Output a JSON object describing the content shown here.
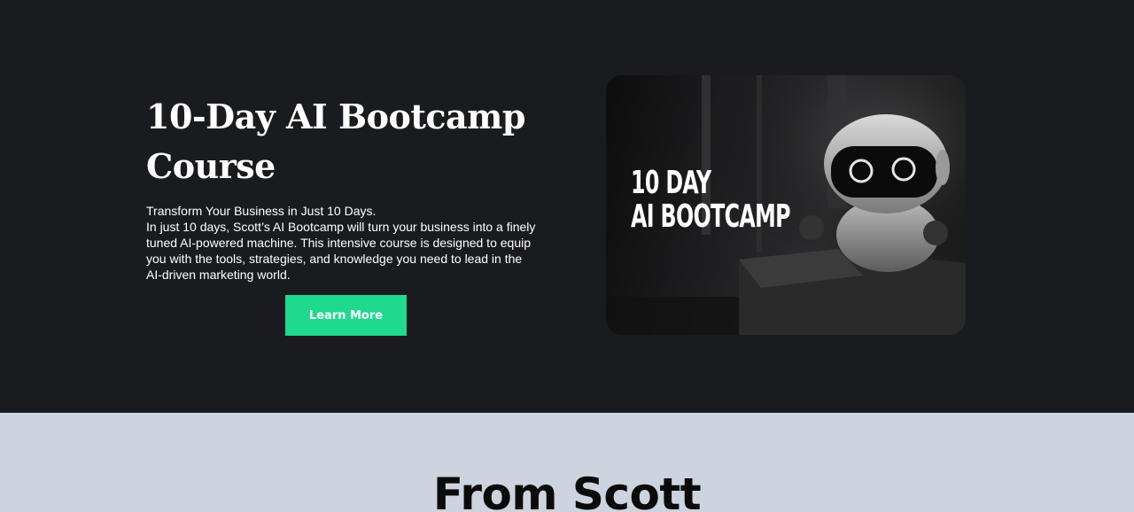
{
  "hero": {
    "title": "10-Day AI Bootcamp Course",
    "tagline": "Transform Your Business in Just 10 Days.",
    "description": "In just 10 days, Scott’s AI Bootcamp will turn your business into a finely tuned AI-powered machine. This intensive course is designed to equip you with the tools, strategies, and knowledge you need to lead in the AI-driven marketing world.",
    "cta_label": "Learn More",
    "image": {
      "headline_line1": "10 DAY",
      "headline_line2": "AI BOOTCAMP",
      "subject_icon": "robot-icon"
    }
  },
  "about": {
    "title": "From Scott"
  },
  "colors": {
    "hero_bg": "#1a1b1f",
    "accent": "#1ed98e",
    "section_bg": "#ccd5df"
  }
}
